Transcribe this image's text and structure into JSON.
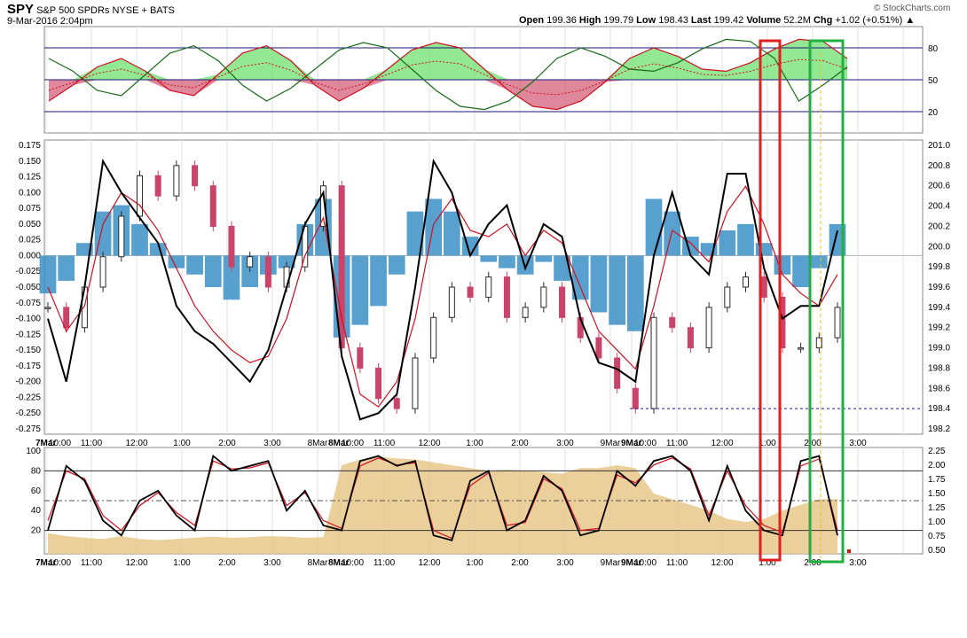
{
  "header": {
    "symbol": "SPY",
    "name": "S&P 500 SPDRs",
    "exchange": "NYSE + BATS",
    "date": "9-Mar-2016 2:04pm",
    "open_label": "Open",
    "open": "199.36",
    "high_label": "High",
    "high": "199.79",
    "low_label": "Low",
    "low": "198.43",
    "last_label": "Last",
    "last": "199.42",
    "volume_label": "Volume",
    "volume": "52.2M",
    "chg_label": "Chg",
    "chg": "+1.02 (+0.51%)",
    "watermark": "© StockCharts.com"
  },
  "colors": {
    "up_candle": "#2b2b2b",
    "down_candle": "#c8446b",
    "histogram": "#3b8fc4",
    "black_line": "#000000",
    "red_line": "#d01020",
    "green_fill": "#6fe06f",
    "pink_fill": "#d5607a",
    "tan_fill": "#e8c88a",
    "red_box": "#e02020",
    "green_box": "#20b040"
  },
  "chart_data": [
    {
      "type": "line",
      "name": "top-oscillator",
      "y_ticks": [
        "80",
        "50",
        "20"
      ],
      "levels": [
        80,
        50,
        20
      ],
      "series": [
        {
          "name": "",
          "values": [
            30,
            45,
            62,
            70,
            58,
            40,
            35,
            55,
            75,
            82,
            68,
            45,
            30,
            42,
            60,
            78,
            85,
            80,
            60,
            40,
            25,
            22,
            30,
            48,
            70,
            80,
            72,
            60,
            58,
            66,
            79,
            88,
            86,
            70
          ]
        }
      ]
    },
    {
      "type": "bar",
      "name": "main-panel",
      "left_ticks": [
        "0.175",
        "0.150",
        "0.125",
        "0.100",
        "0.075",
        "0.050",
        "0.025",
        "0.000",
        "-0.025",
        "-0.050",
        "-0.075",
        "-0.100",
        "-0.125",
        "-0.150",
        "-0.175",
        "-0.200",
        "-0.225",
        "-0.250",
        "-0.275"
      ],
      "right_ticks": [
        "201.0",
        "200.8",
        "200.6",
        "200.4",
        "200.2",
        "200.0",
        "199.8",
        "199.6",
        "199.4",
        "199.2",
        "199.0",
        "198.8",
        "198.6",
        "198.4",
        "198.2"
      ],
      "ylim_left": [
        -0.275,
        0.175
      ],
      "ylim_right": [
        198.2,
        201.0
      ],
      "x_labels": [
        "7Mar",
        "10:00",
        "11:00",
        "12:00",
        "1:00",
        "2:00",
        "3:00",
        "8Mar",
        "10:00",
        "11:00",
        "12:00",
        "1:00",
        "2:00",
        "3:00",
        "9Mar",
        "10:00",
        "11:00",
        "12:00",
        "1:00",
        "2:00",
        "3:00"
      ],
      "price_close": [
        199.4,
        199.2,
        199.6,
        199.9,
        200.3,
        200.7,
        200.5,
        200.8,
        200.6,
        200.2,
        199.8,
        199.9,
        199.6,
        199.8,
        200.2,
        200.6,
        199.0,
        198.8,
        198.5,
        198.4,
        198.9,
        199.3,
        199.6,
        199.5,
        199.7,
        199.3,
        199.4,
        199.6,
        199.3,
        199.1,
        198.9,
        198.6,
        198.4,
        199.3,
        199.2,
        199.0,
        199.4,
        199.6,
        199.7,
        199.5,
        199.0,
        199.0,
        199.1,
        199.4
      ],
      "histogram": [
        -0.06,
        -0.04,
        0.02,
        0.07,
        0.08,
        0.05,
        0.02,
        -0.02,
        -0.03,
        -0.05,
        -0.07,
        -0.05,
        -0.03,
        -0.02,
        0.05,
        0.09,
        -0.13,
        -0.11,
        -0.08,
        -0.03,
        0.07,
        0.09,
        0.07,
        0.03,
        -0.01,
        -0.02,
        -0.03,
        -0.01,
        -0.04,
        -0.07,
        -0.09,
        -0.11,
        -0.12,
        0.09,
        0.07,
        0.03,
        0.02,
        0.04,
        0.05,
        0.02,
        -0.03,
        -0.05,
        -0.02,
        0.05
      ],
      "black_line": [
        -0.1,
        -0.2,
        -0.05,
        0.15,
        0.1,
        0.06,
        0.02,
        -0.08,
        -0.12,
        -0.14,
        -0.17,
        -0.2,
        -0.15,
        -0.05,
        0.05,
        0.1,
        -0.16,
        -0.26,
        -0.25,
        -0.22,
        -0.05,
        0.15,
        0.1,
        0.0,
        0.05,
        0.08,
        -0.02,
        0.05,
        0.03,
        -0.1,
        -0.17,
        -0.18,
        -0.2,
        0.0,
        0.1,
        0.0,
        -0.03,
        0.13,
        0.13,
        -0.02,
        -0.1,
        -0.08,
        -0.08,
        0.04
      ],
      "red_line": [
        -0.05,
        -0.12,
        -0.08,
        0.05,
        0.1,
        0.08,
        0.04,
        -0.02,
        -0.08,
        -0.12,
        -0.15,
        -0.17,
        -0.16,
        -0.1,
        0.0,
        0.06,
        -0.1,
        -0.22,
        -0.24,
        -0.2,
        -0.1,
        0.05,
        0.09,
        0.04,
        0.03,
        0.05,
        0.0,
        0.04,
        0.02,
        -0.05,
        -0.12,
        -0.15,
        -0.18,
        -0.08,
        0.04,
        0.02,
        -0.01,
        0.07,
        0.11,
        0.05,
        -0.03,
        -0.06,
        -0.08,
        -0.03
      ]
    },
    {
      "type": "area",
      "name": "bottom-panel",
      "left_ticks": [
        "100",
        "80",
        "60",
        "40",
        "20"
      ],
      "right_ticks": [
        "2.25",
        "2.00",
        "1.75",
        "1.50",
        "1.25",
        "1.00",
        "0.75",
        "0.50"
      ],
      "x_labels": [
        "7Mar",
        "10:00",
        "11:00",
        "12:00",
        "1:00",
        "2:00",
        "3:00",
        "8Mar",
        "10:00",
        "11:00",
        "12:00",
        "1:00",
        "2:00",
        "3:00",
        "9Mar",
        "10:00",
        "11:00",
        "12:00",
        "1:00",
        "2:00",
        "3:00"
      ],
      "area_values": [
        0.8,
        0.75,
        0.72,
        0.7,
        0.75,
        0.7,
        0.68,
        0.7,
        0.72,
        0.74,
        0.72,
        0.73,
        0.75,
        0.74,
        0.72,
        0.73,
        2.0,
        2.1,
        2.15,
        2.12,
        2.1,
        2.05,
        2.0,
        1.95,
        1.9,
        1.92,
        1.9,
        1.88,
        1.85,
        1.95,
        1.95,
        2.0,
        1.95,
        1.5,
        1.4,
        1.3,
        1.2,
        1.05,
        1.0,
        1.05,
        1.2,
        1.3,
        1.4,
        1.4
      ],
      "black_line": [
        20,
        85,
        70,
        30,
        15,
        50,
        60,
        35,
        20,
        95,
        80,
        85,
        90,
        40,
        60,
        25,
        20,
        90,
        95,
        85,
        90,
        15,
        10,
        70,
        80,
        20,
        30,
        75,
        60,
        15,
        20,
        80,
        65,
        90,
        95,
        80,
        30,
        85,
        40,
        20,
        15,
        90,
        95,
        15
      ],
      "red_line": [
        30,
        80,
        72,
        35,
        20,
        45,
        58,
        38,
        25,
        90,
        82,
        83,
        88,
        45,
        58,
        30,
        22,
        85,
        93,
        86,
        88,
        20,
        12,
        65,
        78,
        25,
        28,
        72,
        62,
        20,
        22,
        76,
        68,
        86,
        93,
        82,
        35,
        80,
        45,
        25,
        18,
        85,
        92,
        20
      ]
    }
  ],
  "annotations": {
    "red_box": "",
    "green_box": ""
  }
}
